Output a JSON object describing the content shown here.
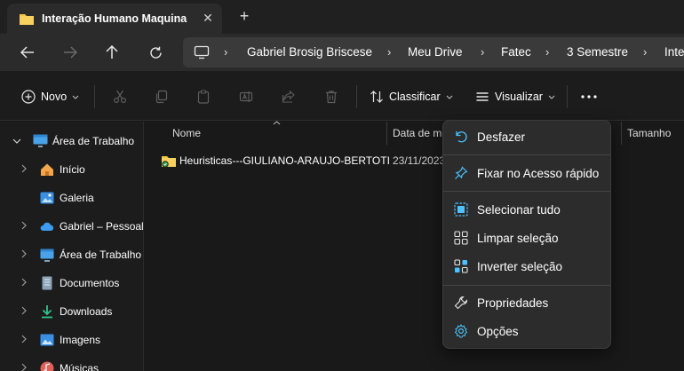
{
  "tab": {
    "title": "Interação Humano Maquina",
    "close_label": "✕",
    "new_tab_label": "+"
  },
  "breadcrumb": [
    "Gabriel Brosig Briscese",
    "Meu Drive",
    "Fatec",
    "3 Semestre",
    "Inter"
  ],
  "toolbar": {
    "new_label": "Novo",
    "sort_label": "Classificar",
    "view_label": "Visualizar",
    "more_label": "···"
  },
  "sidebar": {
    "items": [
      {
        "label": "Área de Trabalho",
        "icon": "desktop-icon"
      },
      {
        "label": "Início",
        "icon": "home-icon"
      },
      {
        "label": "Galeria",
        "icon": "gallery-icon"
      },
      {
        "label": "Gabriel – Pessoal",
        "icon": "onedrive-icon"
      },
      {
        "label": "Área de Trabalho",
        "icon": "desktop-icon"
      },
      {
        "label": "Documentos",
        "icon": "documents-icon"
      },
      {
        "label": "Downloads",
        "icon": "downloads-icon"
      },
      {
        "label": "Imagens",
        "icon": "pictures-icon"
      },
      {
        "label": "Músicas",
        "icon": "music-icon"
      }
    ]
  },
  "columns": {
    "name": "Nome",
    "date": "Data de m",
    "size": "Tamanho"
  },
  "files": [
    {
      "name": "Heuristicas---GIULIANO-ARAUJO-BERTOTI",
      "date": "23/11/2023"
    }
  ],
  "menu": {
    "undo": "Desfazer",
    "pin": "Fixar no Acesso rápido",
    "select_all": "Selecionar tudo",
    "clear_selection": "Limpar seleção",
    "invert_selection": "Inverter seleção",
    "properties": "Propriedades",
    "options": "Opções"
  },
  "colors": {
    "accent": "#4cc2ff",
    "folder": "#f3c542",
    "background": "#191919"
  }
}
